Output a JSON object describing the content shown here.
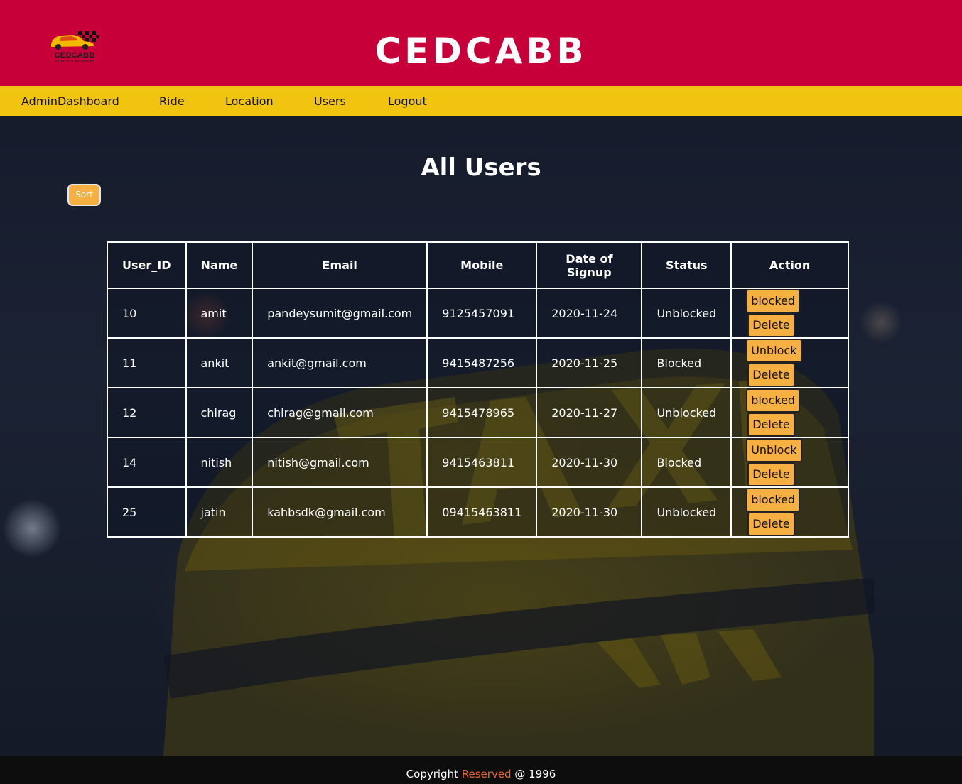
{
  "brand": {
    "logo_text": "CEDCABB",
    "logo_tagline": "RIDES AND RECOVERY",
    "title": "CEDCABB",
    "colors": {
      "header": "#c8003a",
      "nav": "#f1c40f",
      "button": "#f5b041",
      "footer_accent": "#e8662c"
    }
  },
  "nav": {
    "items": [
      {
        "label": "AdminDashboard"
      },
      {
        "label": "Ride"
      },
      {
        "label": "Location"
      },
      {
        "label": "Users"
      },
      {
        "label": "Logout"
      }
    ]
  },
  "main": {
    "heading": "All Users",
    "sort_label": "Sort"
  },
  "table": {
    "columns": [
      "User_ID",
      "Name",
      "Email",
      "Mobile",
      "Date of Signup",
      "Status",
      "Action"
    ],
    "rows": [
      {
        "id": "10",
        "name": "amit",
        "email": "pandeysumit@gmail.com",
        "mobile": "9125457091",
        "date": "2020-11-24",
        "status": "Unblocked",
        "toggle": "blocked",
        "delete": "Delete"
      },
      {
        "id": "11",
        "name": "ankit",
        "email": "ankit@gmail.com",
        "mobile": "9415487256",
        "date": "2020-11-25",
        "status": "Blocked",
        "toggle": "Unblock",
        "delete": "Delete"
      },
      {
        "id": "12",
        "name": "chirag",
        "email": "chirag@gmail.com",
        "mobile": "9415478965",
        "date": "2020-11-27",
        "status": "Unblocked",
        "toggle": "blocked",
        "delete": "Delete"
      },
      {
        "id": "14",
        "name": "nitish",
        "email": "nitish@gmail.com",
        "mobile": "9415463811",
        "date": "2020-11-30",
        "status": "Blocked",
        "toggle": "Unblock",
        "delete": "Delete"
      },
      {
        "id": "25",
        "name": "jatin",
        "email": "kahbsdk@gmail.com",
        "mobile": "09415463811",
        "date": "2020-11-30",
        "status": "Unblocked",
        "toggle": "blocked",
        "delete": "Delete"
      }
    ]
  },
  "footer": {
    "prefix": "Copyright",
    "highlight": "Reserved",
    "suffix": "@ 1996"
  }
}
